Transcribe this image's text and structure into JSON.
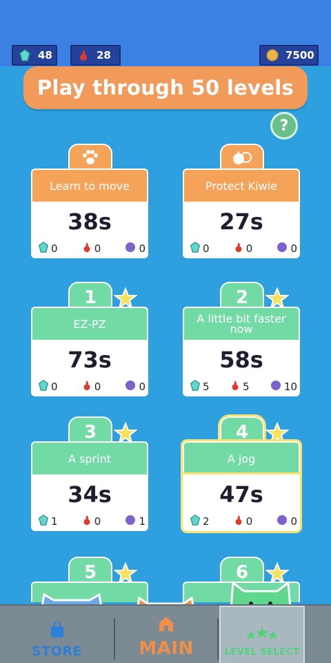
{
  "resources": {
    "gems": "48",
    "fire": "28",
    "coins": "7500"
  },
  "banner": {
    "title": "Play through 50 levels"
  },
  "help": {
    "label": "?"
  },
  "levels": [
    {
      "number": "",
      "icon": "paw-icon",
      "name": "Learn to move",
      "time": "38s",
      "gems": "0",
      "fire": "0",
      "berries": "0",
      "color": "orange",
      "starred": false
    },
    {
      "number": "",
      "icon": "kiwi-icon",
      "name": "Protect Kiwie",
      "time": "27s",
      "gems": "0",
      "fire": "0",
      "berries": "0",
      "color": "orange",
      "starred": false
    },
    {
      "number": "1",
      "name": "EZ-PZ",
      "time": "73s",
      "gems": "0",
      "fire": "0",
      "berries": "0",
      "color": "green",
      "starred": true
    },
    {
      "number": "2",
      "name": "A little bit faster now",
      "time": "58s",
      "gems": "5",
      "fire": "5",
      "berries": "10",
      "color": "green",
      "starred": true
    },
    {
      "number": "3",
      "name": "A sprint",
      "time": "34s",
      "gems": "1",
      "fire": "0",
      "berries": "1",
      "color": "green",
      "starred": true
    },
    {
      "number": "4",
      "name": "A jog",
      "time": "47s",
      "gems": "2",
      "fire": "0",
      "berries": "0",
      "color": "green",
      "starred": true,
      "active": true
    },
    {
      "number": "5",
      "name": "",
      "time": "",
      "color": "green",
      "starred": true
    },
    {
      "number": "6",
      "name": "",
      "time": "",
      "color": "green",
      "starred": true
    }
  ],
  "nav": {
    "store": "STORE",
    "main": "MAIN",
    "level_select": "LEVEL SELECT"
  },
  "colors": {
    "background": "#2fa0df",
    "topbar": "#3c80e4",
    "banner": "#f29a5a",
    "card_orange": "#f6a35a",
    "card_green": "#72dba5",
    "nav": "#7c8b93"
  }
}
